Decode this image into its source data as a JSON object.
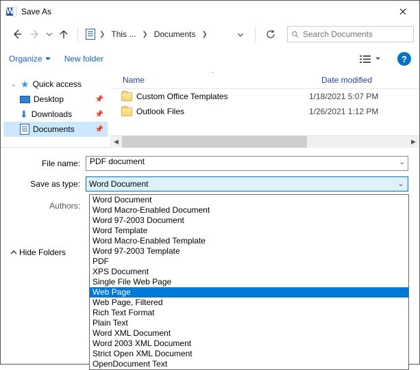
{
  "title": "Save As",
  "breadcrumb": {
    "a": "This ...",
    "b": "Documents"
  },
  "search_placeholder": "Search Documents",
  "toolbar": {
    "organize": "Organize",
    "newfolder": "New folder"
  },
  "sidebar": {
    "quick": "Quick access",
    "desktop": "Desktop",
    "downloads": "Downloads",
    "documents": "Documents"
  },
  "columns": {
    "name": "Name",
    "date": "Date modified"
  },
  "files": [
    {
      "name": "Custom Office Templates",
      "date": "1/18/2021 5:07 PM"
    },
    {
      "name": "Outlook Files",
      "date": "1/26/2021 1:12 PM"
    }
  ],
  "form": {
    "filename_label": "File name:",
    "filename_value": "PDF document",
    "type_label": "Save as type:",
    "type_value": "Word Document",
    "authors_label": "Authors:"
  },
  "hide_folders": "Hide Folders",
  "type_options": [
    "Word Document",
    "Word Macro-Enabled Document",
    "Word 97-2003 Document",
    "Word Template",
    "Word Macro-Enabled Template",
    "Word 97-2003 Template",
    "PDF",
    "XPS Document",
    "Single File Web Page",
    "Web Page",
    "Web Page, Filtered",
    "Rich Text Format",
    "Plain Text",
    "Word XML Document",
    "Word 2003 XML Document",
    "Strict Open XML Document",
    "OpenDocument Text"
  ],
  "type_highlight_index": 9
}
